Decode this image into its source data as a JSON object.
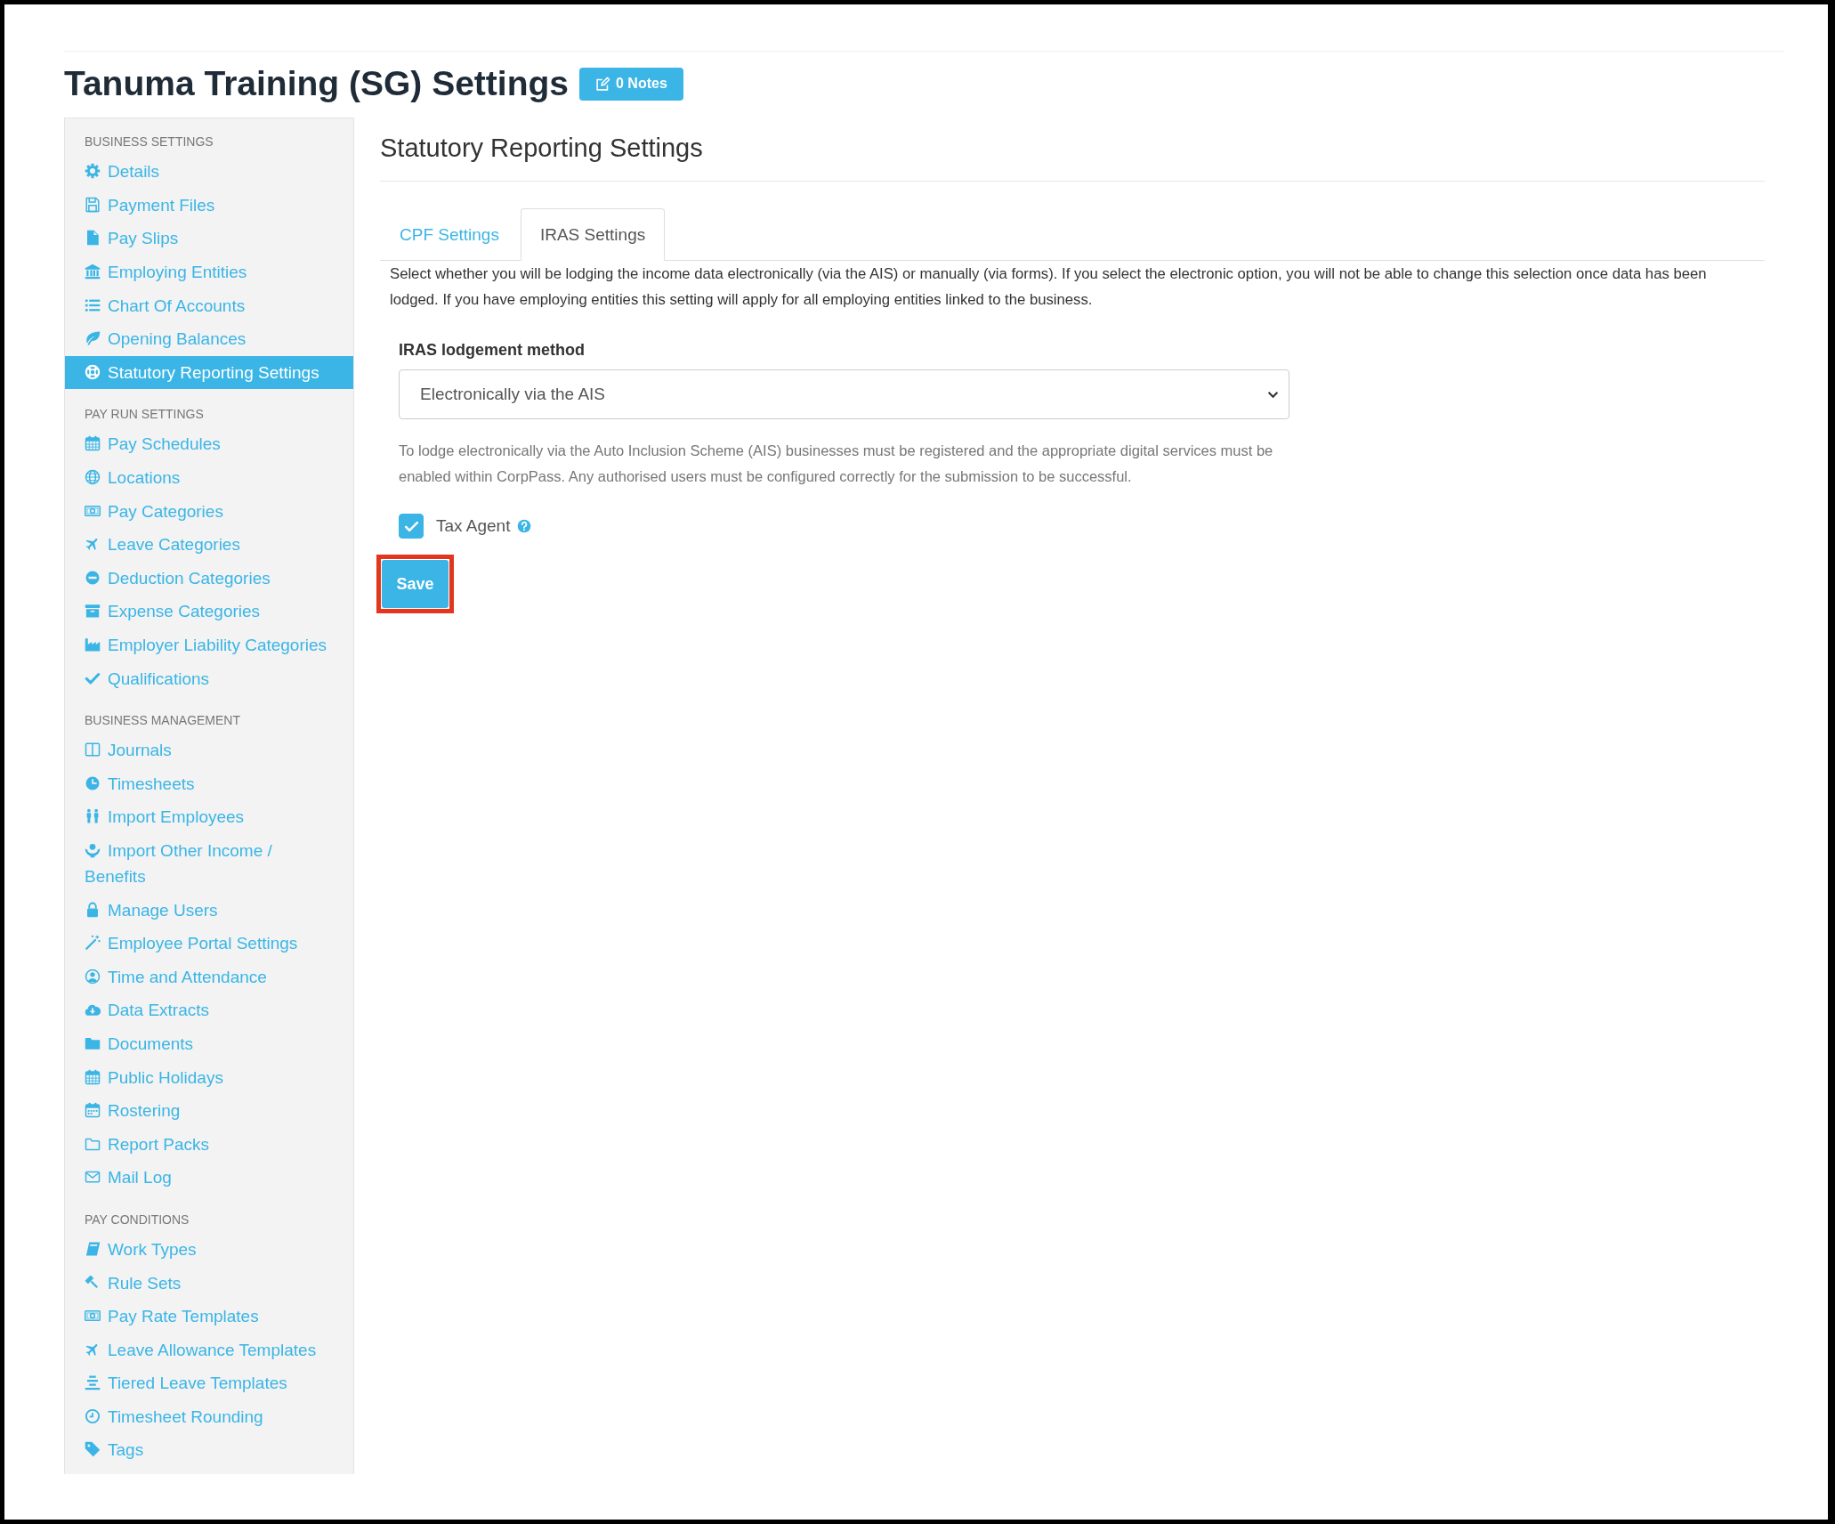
{
  "page": {
    "title": "Tanuma Training (SG) Settings",
    "notes_button": {
      "label": "0 Notes"
    }
  },
  "sidebar": {
    "sections": [
      {
        "heading": "BUSINESS SETTINGS",
        "items": [
          {
            "label": "Details",
            "selected": false
          },
          {
            "label": "Payment Files",
            "selected": false
          },
          {
            "label": "Pay Slips",
            "selected": false
          },
          {
            "label": "Employing Entities",
            "selected": false
          },
          {
            "label": "Chart Of Accounts",
            "selected": false
          },
          {
            "label": "Opening Balances",
            "selected": false
          },
          {
            "label": "Statutory Reporting Settings",
            "selected": true
          }
        ]
      },
      {
        "heading": "PAY RUN SETTINGS",
        "items": [
          {
            "label": "Pay Schedules",
            "selected": false
          },
          {
            "label": "Locations",
            "selected": false
          },
          {
            "label": "Pay Categories",
            "selected": false
          },
          {
            "label": "Leave Categories",
            "selected": false
          },
          {
            "label": "Deduction Categories",
            "selected": false
          },
          {
            "label": "Expense Categories",
            "selected": false
          },
          {
            "label": "Employer Liability Categories",
            "selected": false
          },
          {
            "label": "Qualifications",
            "selected": false
          }
        ]
      },
      {
        "heading": "BUSINESS MANAGEMENT",
        "items": [
          {
            "label": "Journals",
            "selected": false
          },
          {
            "label": "Timesheets",
            "selected": false
          },
          {
            "label": "Import Employees",
            "selected": false
          },
          {
            "label": "Import Other Income / Benefits",
            "selected": false
          },
          {
            "label": "Manage Users",
            "selected": false
          },
          {
            "label": "Employee Portal Settings",
            "selected": false
          },
          {
            "label": "Time and Attendance",
            "selected": false
          },
          {
            "label": "Data Extracts",
            "selected": false
          },
          {
            "label": "Documents",
            "selected": false
          },
          {
            "label": "Public Holidays",
            "selected": false
          },
          {
            "label": "Rostering",
            "selected": false
          },
          {
            "label": "Report Packs",
            "selected": false
          },
          {
            "label": "Mail Log",
            "selected": false
          }
        ]
      },
      {
        "heading": "PAY CONDITIONS",
        "items": [
          {
            "label": "Work Types",
            "selected": false
          },
          {
            "label": "Rule Sets",
            "selected": false
          },
          {
            "label": "Pay Rate Templates",
            "selected": false
          },
          {
            "label": "Leave Allowance Templates",
            "selected": false
          },
          {
            "label": "Tiered Leave Templates",
            "selected": false
          },
          {
            "label": "Timesheet Rounding",
            "selected": false
          },
          {
            "label": "Tags",
            "selected": false
          }
        ]
      }
    ]
  },
  "content": {
    "heading": "Statutory Reporting Settings",
    "tabs": [
      {
        "label": "CPF Settings",
        "selected": false
      },
      {
        "label": "IRAS Settings",
        "selected": true
      }
    ],
    "description": "Select whether you will be lodging the income data electronically (via the AIS) or manually (via forms). If you select the electronic option, you will not be able to change this selection once data has been lodged. If you have employing entities this setting will apply for all employing entities linked to the business.",
    "lodgement_method": {
      "label": "IRAS lodgement method",
      "value": "Electronically via the AIS"
    },
    "help_text": "To lodge electronically via the Auto Inclusion Scheme (AIS) businesses must be registered and the appropriate digital services must be enabled within CorpPass. Any authorised users must be configured correctly for the submission to be successful.",
    "tax_agent": {
      "label": "Tax Agent",
      "checked": true
    },
    "save_button": {
      "label": "Save",
      "highlighted": true
    }
  }
}
